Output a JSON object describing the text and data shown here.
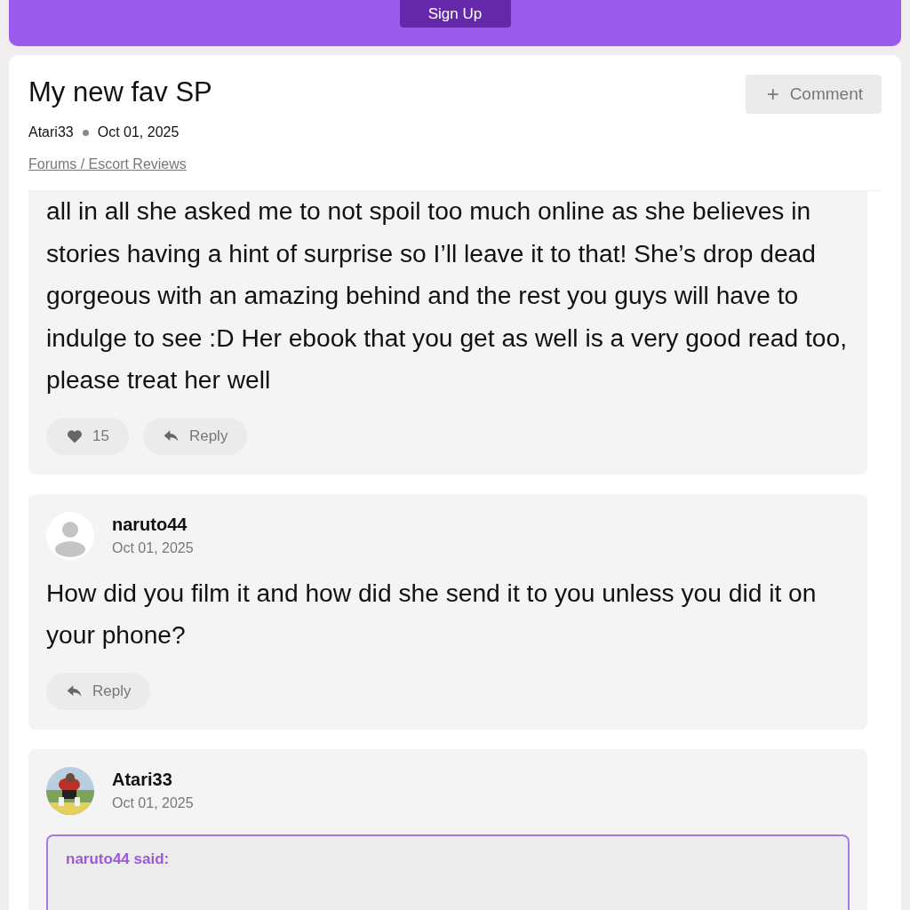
{
  "banner": {
    "button": "Sign Up"
  },
  "thread": {
    "title": "My new fav SP",
    "author": "Atari33",
    "date": "Oct 01, 2025",
    "breadcrumb": "Forums / Escort Reviews",
    "comment_button": "Comment",
    "comment_icon": "+"
  },
  "posts": [
    {
      "body": "all in all she asked me to not spoil too much online as she believes in stories having a hint of surprise so I’ll leave it to that! She’s drop dead gorgeous with an amazing behind and the rest you guys will have to indulge to see :D Her ebook that you get as well is a very good read too, please treat her well",
      "likes": "15",
      "reply": "Reply"
    },
    {
      "avatar": {
        "kind": "placeholder"
      },
      "author": "naruto44",
      "date": "Oct 01, 2025",
      "body": "How did you film it and how did she send it to you unless you did it on your phone?",
      "reply": "Reply"
    },
    {
      "author": "Atari33",
      "date": "Oct 01, 2025",
      "quote": {
        "said": "naruto44 said:"
      }
    }
  ]
}
